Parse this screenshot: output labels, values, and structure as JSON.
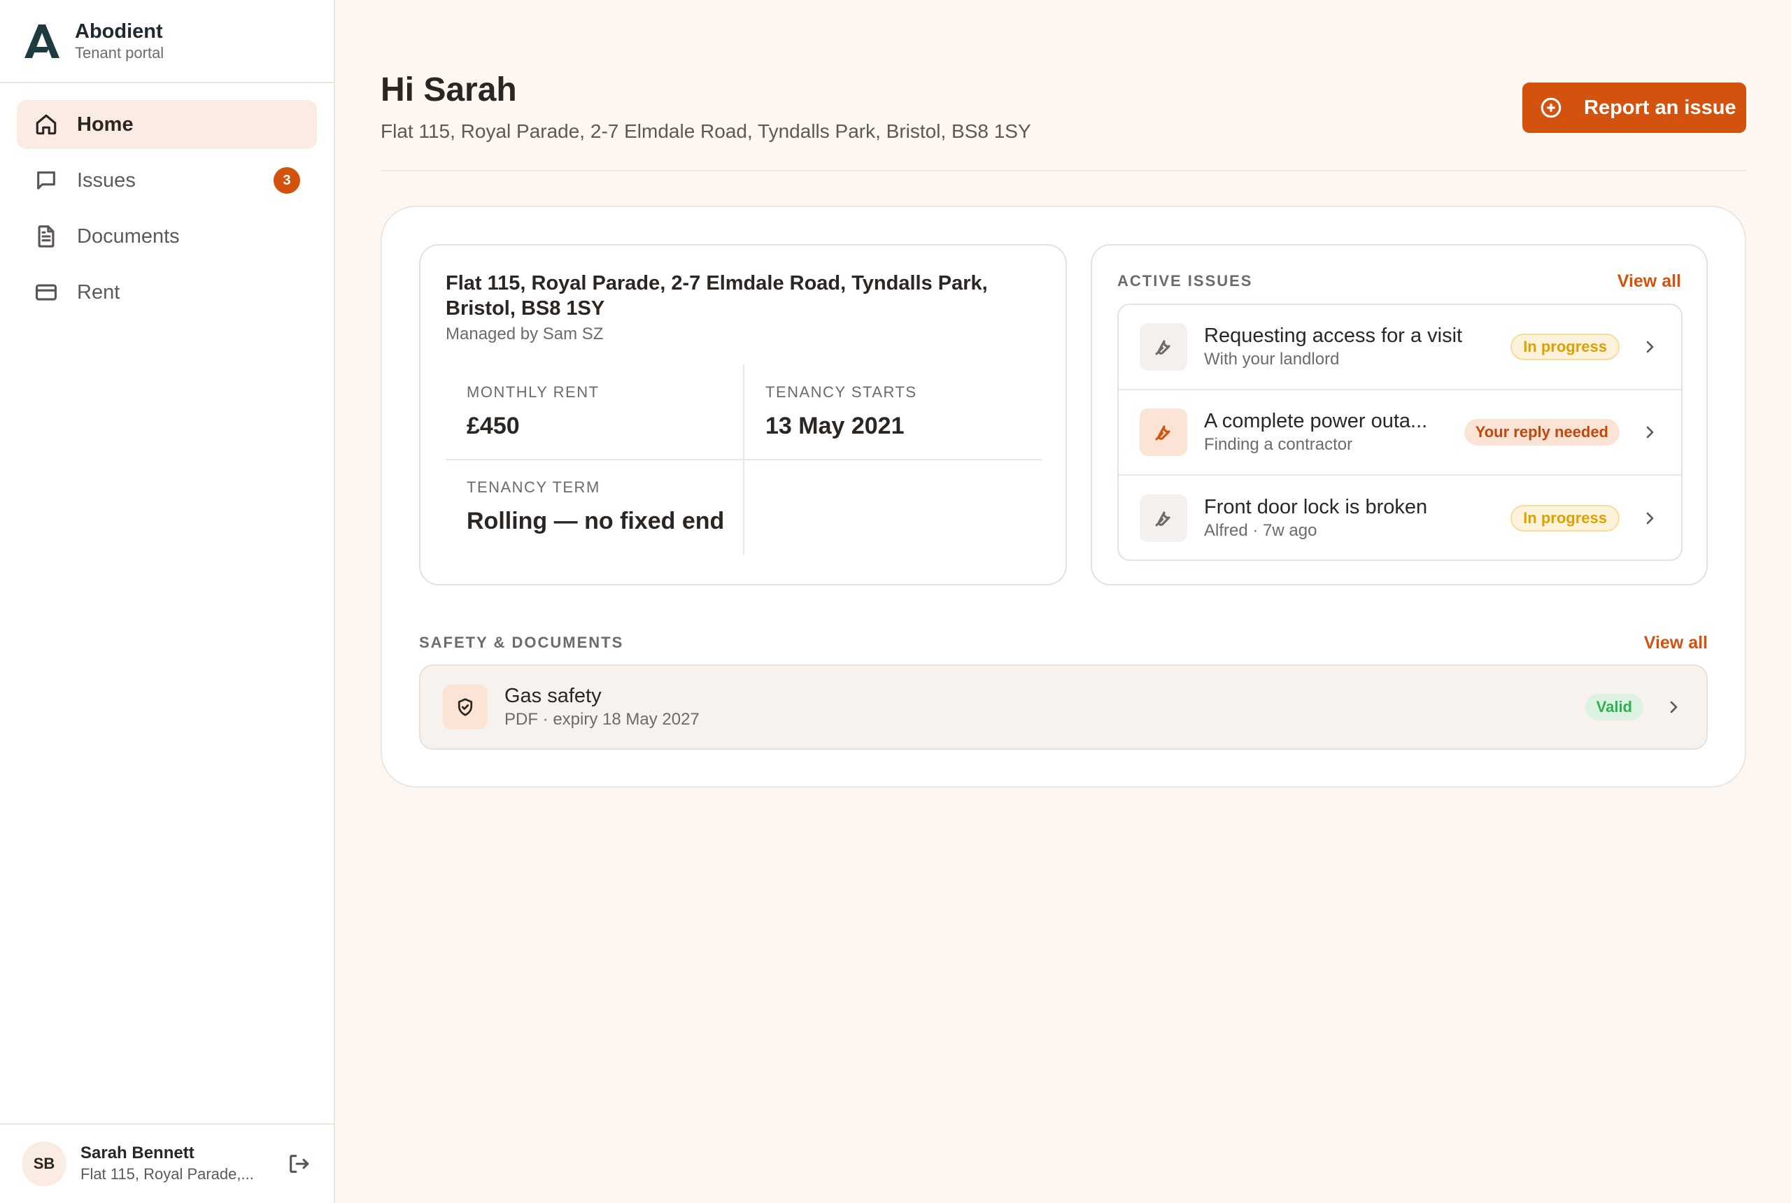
{
  "brand": {
    "name": "Abodient",
    "subtitle": "Tenant portal"
  },
  "sidebar": {
    "items": [
      {
        "label": "Home",
        "icon": "home-icon",
        "active": true
      },
      {
        "label": "Issues",
        "icon": "message-icon",
        "badge": "3"
      },
      {
        "label": "Documents",
        "icon": "document-icon"
      },
      {
        "label": "Rent",
        "icon": "card-icon"
      }
    ]
  },
  "user": {
    "initials": "SB",
    "name": "Sarah Bennett",
    "address": "Flat 115, Royal Parade,..."
  },
  "header": {
    "greeting": "Hi Sarah",
    "address": "Flat 115, Royal Parade, 2-7 Elmdale Road, Tyndalls Park, Bristol, BS8 1SY",
    "report_button": "Report an issue"
  },
  "property": {
    "title": "Flat 115, Royal Parade, 2-7 Elmdale Road, Tyndalls Park, Bristol, BS8 1SY",
    "manager": "Managed by Sam SZ",
    "stats": [
      {
        "label": "MONTHLY RENT",
        "value": "£450"
      },
      {
        "label": "TENANCY STARTS",
        "value": "13 May 2021"
      },
      {
        "label": "TENANCY TERM",
        "value": "Rolling — no fixed end"
      }
    ]
  },
  "active_issues": {
    "title": "ACTIVE ISSUES",
    "view_all": "View all",
    "items": [
      {
        "title": "Requesting access for a visit",
        "subtitle": "With your landlord",
        "status": "In progress",
        "icon": "wrench-icon"
      },
      {
        "title": "A complete power outa...",
        "subtitle": "Finding a contractor",
        "status": "Your reply needed",
        "icon": "wrench-icon"
      },
      {
        "title": "Front door lock is broken",
        "subtitle": "Alfred · 7w ago",
        "status": "In progress",
        "icon": "wrench-icon"
      }
    ]
  },
  "documents": {
    "title": "SAFETY & DOCUMENTS",
    "view_all": "View all",
    "items": [
      {
        "title": "Gas safety",
        "subtitle": "PDF · expiry 18 May 2027",
        "status": "Valid",
        "icon": "shield-icon"
      }
    ]
  },
  "colors": {
    "accent": "#d2520e",
    "background": "#fdf6f1",
    "progress": "#e0a000",
    "valid": "#2fae54"
  }
}
